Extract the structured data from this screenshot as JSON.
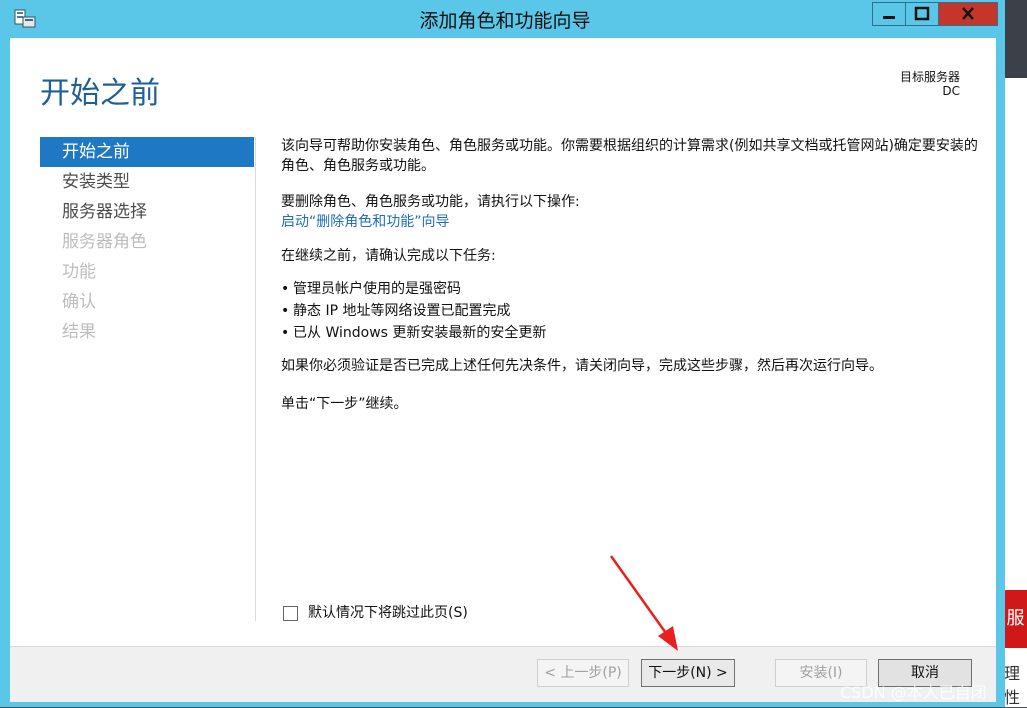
{
  "window": {
    "title": "添加角色和功能向导",
    "accent_color": "#5bc7e8"
  },
  "header": {
    "page_title": "开始之前",
    "target_server_label": "目标服务器",
    "target_server_value": "DC"
  },
  "nav": {
    "items": [
      {
        "label": "开始之前",
        "state": "active"
      },
      {
        "label": "安装类型",
        "state": "enabled"
      },
      {
        "label": "服务器选择",
        "state": "enabled"
      },
      {
        "label": "服务器角色",
        "state": "disabled"
      },
      {
        "label": "功能",
        "state": "disabled"
      },
      {
        "label": "确认",
        "state": "disabled"
      },
      {
        "label": "结果",
        "state": "disabled"
      }
    ]
  },
  "content": {
    "intro": "该向导可帮助你安装角色、角色服务或功能。你需要根据组织的计算需求(例如共享文档或托管网站)确定要安装的角色、角色服务或功能。",
    "remove_text": "要删除角色、角色服务或功能，请执行以下操作:",
    "remove_link": "启动“删除角色和功能”向导",
    "before_text": "在继续之前，请确认完成以下任务:",
    "tasks": [
      "管理员帐户使用的是强密码",
      "静态 IP 地址等网络设置已配置完成",
      "已从 Windows 更新安装最新的安全更新"
    ],
    "verify_text": "如果你必须验证是否已完成上述任何先决条件，请关闭向导，完成这些步骤，然后再次运行向导。",
    "next_hint": "单击“下一步”继续。",
    "skip_label": "默认情况下将跳过此页(S)"
  },
  "footer": {
    "prev_label": "< 上一步(P)",
    "next_label": "下一步(N) >",
    "install_label": "安装(I)",
    "cancel_label": "取消"
  },
  "background": {
    "tag_text": "服",
    "side_text": "理性"
  },
  "watermark": "CSDN @本人已自闭"
}
